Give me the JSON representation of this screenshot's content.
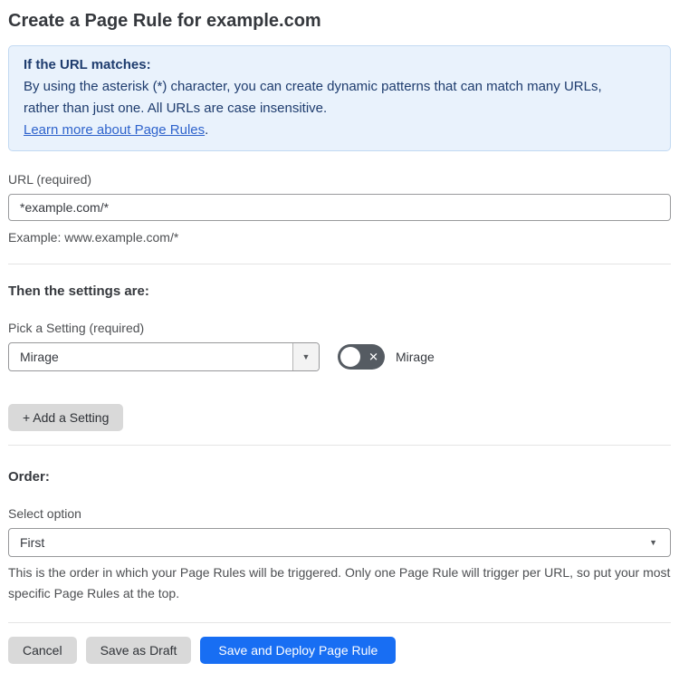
{
  "page": {
    "title": "Create a Page Rule for example.com"
  },
  "info_box": {
    "heading": "If the URL matches:",
    "body": "By using the asterisk (*) character, you can create dynamic patterns that can match many URLs, rather than just one. All URLs are case insensitive.",
    "link_label": "Learn more about Page Rules",
    "link_suffix": "."
  },
  "url_field": {
    "label": "URL (required)",
    "value": "*example.com/*",
    "helper": "Example: www.example.com/*"
  },
  "settings_section": {
    "heading": "Then the settings are:",
    "picker_label": "Pick a Setting (required)",
    "selected_setting": "Mirage",
    "toggle": {
      "state": "off",
      "glyph": "✕",
      "label": "Mirage"
    },
    "add_setting_label": "+ Add a Setting"
  },
  "order_section": {
    "heading": "Order:",
    "select_label": "Select option",
    "selected_option": "First",
    "helper": "This is the order in which your Page Rules will be triggered. Only one Page Rule will trigger per URL, so put your most specific Page Rules at the top."
  },
  "footer": {
    "cancel_label": "Cancel",
    "save_draft_label": "Save as Draft",
    "save_deploy_label": "Save and Deploy Page Rule"
  },
  "icons": {
    "dropdown_caret": "▼"
  },
  "colors": {
    "info_bg": "#e9f2fc",
    "info_border": "#c2d9f2",
    "info_text": "#1e3c6e",
    "link": "#2e63cc",
    "primary_button": "#186ef3",
    "secondary_button": "#d9d9d9",
    "toggle_off": "#555b62"
  }
}
